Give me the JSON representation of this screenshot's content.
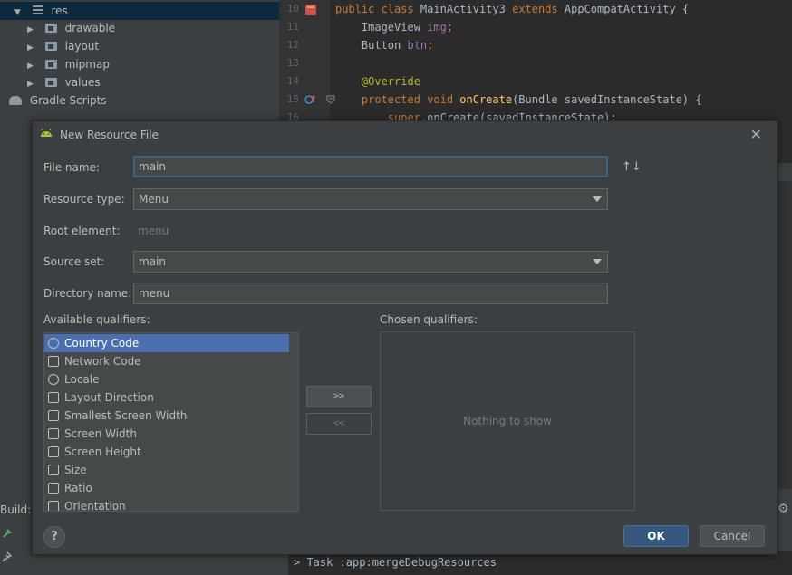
{
  "project_tree": {
    "items": [
      {
        "label": "res",
        "expanded": true
      },
      {
        "label": "drawable",
        "expanded": false
      },
      {
        "label": "layout",
        "expanded": false
      },
      {
        "label": "mipmap",
        "expanded": false
      },
      {
        "label": "values",
        "expanded": false
      },
      {
        "label": "Gradle Scripts",
        "expanded": false
      }
    ]
  },
  "editor": {
    "lines": [
      {
        "num": "10",
        "parts": [
          [
            "kw",
            "public class "
          ],
          [
            "",
            "MainActivity3 "
          ],
          [
            "kw",
            "extends "
          ],
          [
            "",
            "AppCompatActivity {"
          ]
        ]
      },
      {
        "num": "11",
        "parts": [
          [
            "",
            "    ImageView "
          ],
          [
            "fld",
            "img"
          ],
          [
            "kw",
            ";"
          ]
        ]
      },
      {
        "num": "12",
        "parts": [
          [
            "",
            "    Button "
          ],
          [
            "fld",
            "btn"
          ],
          [
            "kw",
            ";"
          ]
        ]
      },
      {
        "num": "13",
        "parts": [
          [
            "",
            ""
          ]
        ]
      },
      {
        "num": "14",
        "parts": [
          [
            "ann",
            "    @Override"
          ]
        ]
      },
      {
        "num": "15",
        "parts": [
          [
            "kw",
            "    protected void "
          ],
          [
            "fn",
            "onCreate"
          ],
          [
            "",
            "(Bundle savedInstanceState) {"
          ]
        ]
      },
      {
        "num": "16",
        "parts": [
          [
            "kw",
            "        super"
          ],
          [
            "",
            ".onCreate(savedInstanceState);"
          ]
        ]
      }
    ]
  },
  "dialog": {
    "title": "New Resource File",
    "file_name_label": "File name:",
    "file_name_value": "main",
    "resource_type_label": "Resource type:",
    "resource_type_value": "Menu",
    "root_element_label": "Root element:",
    "root_element_value": "menu",
    "source_set_label": "Source set:",
    "source_set_value": "main",
    "directory_name_label": "Directory name:",
    "directory_name_value": "menu",
    "available_qualifiers_label": "Available qualifiers:",
    "chosen_qualifiers_label": "Chosen qualifiers:",
    "qualifiers": [
      {
        "label": "Country Code",
        "icon": "globe-icon",
        "selected": true
      },
      {
        "label": "Network Code",
        "icon": "network-icon",
        "selected": false
      },
      {
        "label": "Locale",
        "icon": "globe-icon",
        "selected": false
      },
      {
        "label": "Layout Direction",
        "icon": "direction-icon",
        "selected": false
      },
      {
        "label": "Smallest Screen Width",
        "icon": "expand-icon",
        "selected": false
      },
      {
        "label": "Screen Width",
        "icon": "width-icon",
        "selected": false
      },
      {
        "label": "Screen Height",
        "icon": "height-icon",
        "selected": false
      },
      {
        "label": "Size",
        "icon": "size-icon",
        "selected": false
      },
      {
        "label": "Ratio",
        "icon": "ratio-icon",
        "selected": false
      },
      {
        "label": "Orientation",
        "icon": "orientation-icon",
        "selected": false
      }
    ],
    "add_button": ">>",
    "remove_button": "<<",
    "empty_text": "Nothing to show",
    "help_button": "?",
    "ok_button": "OK",
    "cancel_button": "Cancel"
  },
  "build": {
    "label": "Build:",
    "console_text": "> Task :app:mergeDebugResources"
  },
  "colors": {
    "accent": "#4b6eaf",
    "ok_button": "#365880",
    "background": "#3c3f41"
  }
}
